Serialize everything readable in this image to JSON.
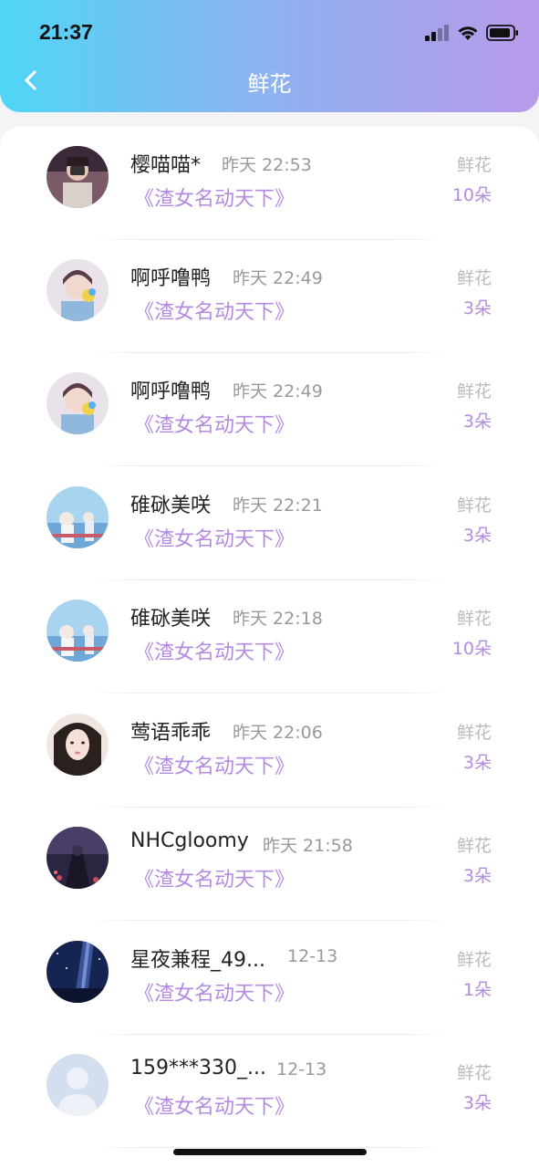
{
  "status_bar": {
    "time": "21:37"
  },
  "header": {
    "title": "鲜花"
  },
  "list": [
    {
      "name": "樱喵喵*",
      "time": "昨天 22:53",
      "book": "《渣女名动天下》",
      "flower_label": "鲜花",
      "count": "10朵",
      "avatar": "avatar-girl-camera"
    },
    {
      "name": "啊呼噜鸭",
      "time": "昨天 22:49",
      "book": "《渣女名动天下》",
      "flower_label": "鲜花",
      "count": "3朵",
      "avatar": "avatar-anime-boy"
    },
    {
      "name": "啊呼噜鸭",
      "time": "昨天 22:49",
      "book": "《渣女名动天下》",
      "flower_label": "鲜花",
      "count": "3朵",
      "avatar": "avatar-anime-boy"
    },
    {
      "name": "碓砯美咲",
      "time": "昨天 22:21",
      "book": "《渣女名动天下》",
      "flower_label": "鲜花",
      "count": "3朵",
      "avatar": "avatar-sky-scene"
    },
    {
      "name": "碓砯美咲",
      "time": "昨天 22:18",
      "book": "《渣女名动天下》",
      "flower_label": "鲜花",
      "count": "10朵",
      "avatar": "avatar-sky-scene"
    },
    {
      "name": "莺语乖乖",
      "time": "昨天 22:06",
      "book": "《渣女名动天下》",
      "flower_label": "鲜花",
      "count": "3朵",
      "avatar": "avatar-girl-photo"
    },
    {
      "name": "NHCgloomy",
      "time": "昨天 21:58",
      "book": "《渣女名动天下》",
      "flower_label": "鲜花",
      "count": "3朵",
      "avatar": "avatar-dark-scene"
    },
    {
      "name": "星夜兼程_49...",
      "time": "12-13",
      "book": "《渣女名动天下》",
      "flower_label": "鲜花",
      "count": "1朵",
      "avatar": "avatar-starry-night"
    },
    {
      "name": "159***330_...",
      "time": "12-13",
      "book": "《渣女名动天下》",
      "flower_label": "鲜花",
      "count": "3朵",
      "avatar": "avatar-default-person"
    }
  ]
}
